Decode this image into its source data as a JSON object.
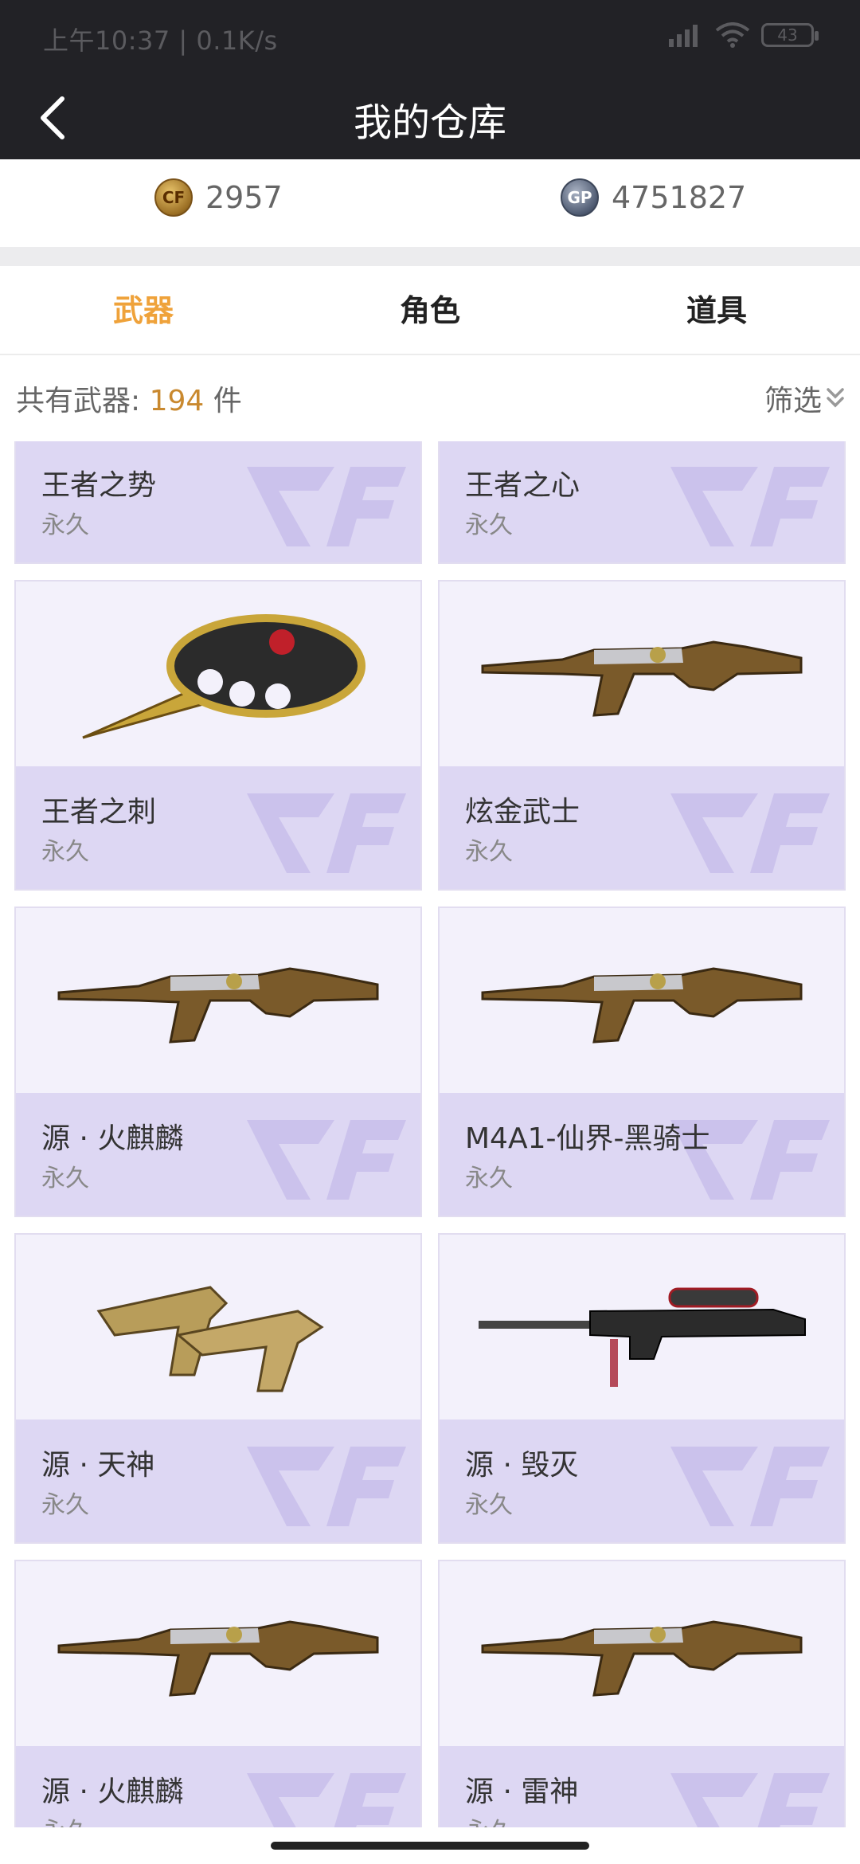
{
  "status": {
    "time_text": "上午10:37 | 0.1K/s",
    "battery": "43"
  },
  "nav": {
    "title": "我的仓库"
  },
  "currency": {
    "cf_points": "2957",
    "gp_points": "4751827",
    "cf_icon_text": "CF",
    "gp_icon_text": "GP"
  },
  "tabs": [
    {
      "label": "武器",
      "active": true
    },
    {
      "label": "角色",
      "active": false
    },
    {
      "label": "道具",
      "active": false
    }
  ],
  "summary": {
    "prefix": "共有武器: ",
    "count": "194",
    "suffix": " 件",
    "filter_label": "筛选"
  },
  "items": [
    {
      "name": "王者之势",
      "duration": "永久",
      "icon": "knife-icon"
    },
    {
      "name": "王者之心",
      "duration": "永久",
      "icon": "rifle-icon"
    },
    {
      "name": "王者之刺",
      "duration": "永久",
      "icon": "knuckle-knife-icon"
    },
    {
      "name": "炫金武士",
      "duration": "永久",
      "icon": "rifle-icon"
    },
    {
      "name": "源 · 火麒麟",
      "duration": "永久",
      "icon": "rifle-icon"
    },
    {
      "name": "M4A1-仙界-黑骑士",
      "duration": "永久",
      "icon": "rifle-icon"
    },
    {
      "name": "源 · 天神",
      "duration": "永久",
      "icon": "dual-pistol-icon"
    },
    {
      "name": "源 · 毁灭",
      "duration": "永久",
      "icon": "sniper-rifle-icon"
    },
    {
      "name": "源 · 火麒麟",
      "duration": "永久",
      "icon": "rifle-icon"
    },
    {
      "name": "源 · 雷神",
      "duration": "永久",
      "icon": "rifle-icon"
    }
  ],
  "colors": {
    "accent": "#efa23a",
    "card_band": "#ddd7f3",
    "card_bg": "#f3f1fb",
    "topbar": "#222226"
  }
}
